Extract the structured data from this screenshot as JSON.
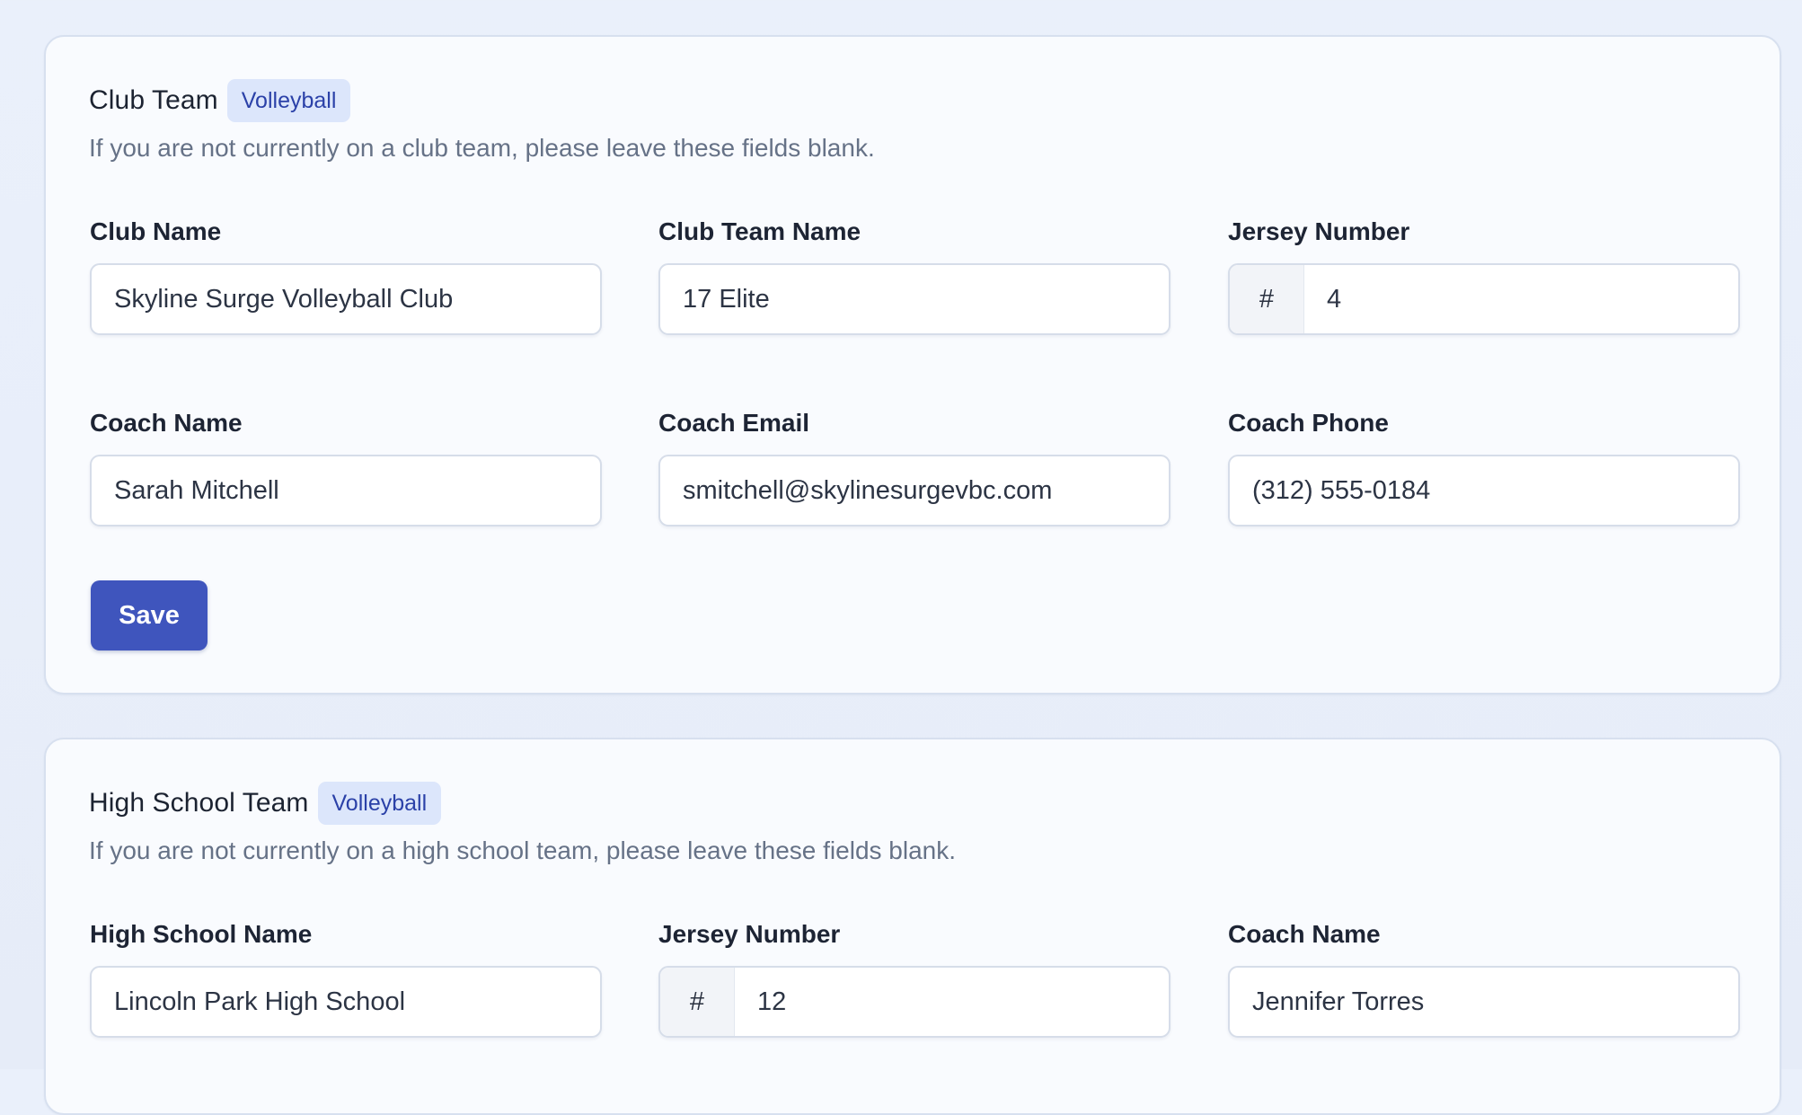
{
  "club": {
    "title": "Club Team",
    "badge": "Volleyball",
    "helper": "If you are not currently on a club team, please leave these fields blank.",
    "fields": {
      "club_name": {
        "label": "Club Name",
        "value": "Skyline Surge Volleyball Club"
      },
      "club_team_name": {
        "label": "Club Team Name",
        "value": "17 Elite"
      },
      "jersey_number": {
        "label": "Jersey Number",
        "prefix": "#",
        "value": "4"
      },
      "coach_name": {
        "label": "Coach Name",
        "value": "Sarah Mitchell"
      },
      "coach_email": {
        "label": "Coach Email",
        "value": "smitchell@skylinesurgevbc.com"
      },
      "coach_phone": {
        "label": "Coach Phone",
        "value": "(312) 555-0184"
      }
    },
    "save_label": "Save"
  },
  "high_school": {
    "title": "High School Team",
    "badge": "Volleyball",
    "helper": "If you are not currently on a high school team, please leave these fields blank.",
    "fields": {
      "school_name": {
        "label": "High School Name",
        "value": "Lincoln Park High School"
      },
      "jersey_number": {
        "label": "Jersey Number",
        "prefix": "#",
        "value": "12"
      },
      "coach_name": {
        "label": "Coach Name",
        "value": "Jennifer Torres"
      }
    }
  },
  "colors": {
    "accent": "#3f55bd",
    "badge_bg": "#dce6fb",
    "badge_text": "#2b41a8",
    "page_bg": "#e8eefa"
  }
}
